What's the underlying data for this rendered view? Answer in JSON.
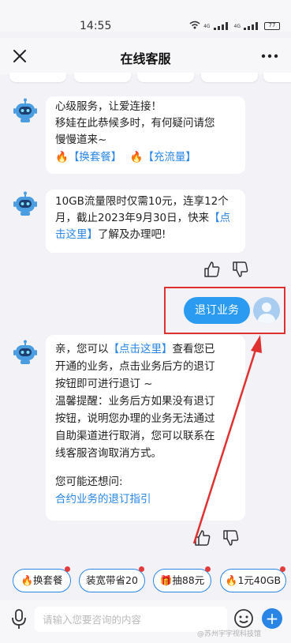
{
  "status_bar": {
    "time": "14:55",
    "signal_label_1": "4G",
    "signal_label_2": "4G",
    "battery": "77"
  },
  "nav": {
    "title": "在线客服"
  },
  "messages": {
    "m1": {
      "line1": "心级服务，让爱连接！",
      "line2": "移娃在此恭候多时，有何疑问请您",
      "line3": "慢慢道来~",
      "link1": "【换套餐】",
      "link2": "【充流量】"
    },
    "m2": {
      "text_a": "10GB流量限时仅需10元，连享12个",
      "text_b": "月，截止2023年9月30日，快来",
      "link": "【点",
      "link_b": "击这里】",
      "text_c": "了解及办理吧!"
    },
    "user": {
      "text": "退订业务"
    },
    "m3": {
      "a1": "亲，您可以",
      "link": "【点击这里】",
      "a2": "查看您已",
      "line2": "开通的业务，点击业务后方的退订",
      "line3": "按钮即可进行退订 ~",
      "line4": "温馨提醒：业务后方如果没有退订",
      "line5": "按钮，说明您办理的业务无法通过",
      "line6": "自助渠道进行取消，您可以联系在",
      "line7": "线客服咨询取消方式。",
      "line8": "您可能还想问:",
      "suggest": "合约业务的退订指引"
    }
  },
  "quick_chips": [
    {
      "label": "换套餐",
      "icon": "fire-icon"
    },
    {
      "label": "装宽带省20",
      "icon": ""
    },
    {
      "label": "抽88元",
      "icon": "gift-icon"
    },
    {
      "label": "1元40GB",
      "icon": "fire-icon"
    }
  ],
  "input": {
    "placeholder": "请输入您要咨询的内容"
  },
  "watermark": "@苏州宇宇视科技馆",
  "colors": {
    "accent": "#2a86e6",
    "highlight": "#e03131",
    "user_bubble": "#2a9bf0"
  }
}
